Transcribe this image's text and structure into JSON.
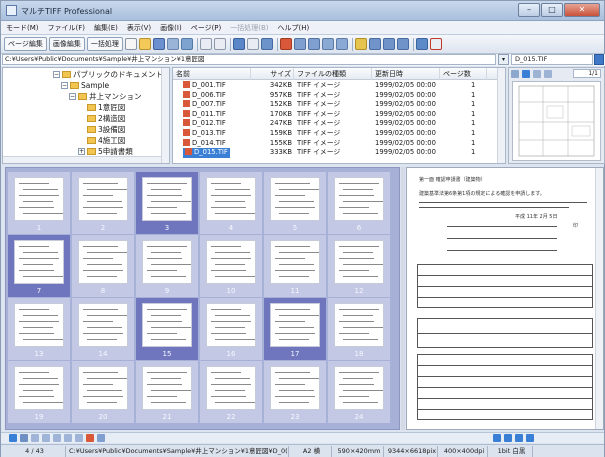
{
  "app": {
    "title": "マルチTIFF Professional"
  },
  "window_buttons": {
    "minimize": "–",
    "maximize": "□",
    "close": "✕"
  },
  "menu": [
    "モード(M)",
    "ファイル(F)",
    "編集(E)",
    "表示(V)",
    "画像(I)",
    "ページ(P)",
    "一括処理(B)",
    "ヘルプ(H)"
  ],
  "toolbar": {
    "page_edit": "ページ編集",
    "image_edit": "画像編集",
    "batch": "一括処理"
  },
  "path": {
    "value": "C:¥Users¥Public¥Documents¥Sample¥井上マンション¥1意匠図",
    "file": "D_015.TIF"
  },
  "tree": {
    "items": [
      {
        "label": "パブリックのドキュメント",
        "level": 1
      },
      {
        "label": "Sample",
        "level": 2
      },
      {
        "label": "井上マンション",
        "level": 3
      },
      {
        "label": "1意匠図",
        "level": 4
      },
      {
        "label": "2構造図",
        "level": 4
      },
      {
        "label": "3設備図",
        "level": 4
      },
      {
        "label": "4施工図",
        "level": 4
      },
      {
        "label": "5申請書類",
        "level": 4
      }
    ]
  },
  "filelist": {
    "columns": [
      "名前",
      "サイズ",
      "ファイルの種類",
      "更新日時",
      "ページ数"
    ],
    "rows": [
      {
        "name": "D_001.TIF",
        "size": "342KB",
        "type": "TIFF イメージ",
        "date": "1999/02/05 00:00",
        "pages": "1"
      },
      {
        "name": "D_006.TIF",
        "size": "957KB",
        "type": "TIFF イメージ",
        "date": "1999/02/05 00:00",
        "pages": "1"
      },
      {
        "name": "D_007.TIF",
        "size": "152KB",
        "type": "TIFF イメージ",
        "date": "1999/02/05 00:00",
        "pages": "1"
      },
      {
        "name": "D_011.TIF",
        "size": "170KB",
        "type": "TIFF イメージ",
        "date": "1999/02/05 00:00",
        "pages": "1"
      },
      {
        "name": "D_012.TIF",
        "size": "247KB",
        "type": "TIFF イメージ",
        "date": "1999/02/05 00:00",
        "pages": "1"
      },
      {
        "name": "D_013.TIF",
        "size": "159KB",
        "type": "TIFF イメージ",
        "date": "1999/02/05 00:00",
        "pages": "1"
      },
      {
        "name": "D_014.TIF",
        "size": "155KB",
        "type": "TIFF イメージ",
        "date": "1999/02/05 00:00",
        "pages": "1"
      },
      {
        "name": "D_015.TIF",
        "size": "333KB",
        "type": "TIFF イメージ",
        "date": "1999/02/05 00:00",
        "pages": "1",
        "selected": true
      }
    ]
  },
  "preview": {
    "page_counter": "1/1"
  },
  "thumbnails": {
    "pages": [
      {
        "num": "1"
      },
      {
        "num": "2"
      },
      {
        "num": "3",
        "selected": true
      },
      {
        "num": "4"
      },
      {
        "num": "5"
      },
      {
        "num": "6"
      },
      {
        "num": "7",
        "selected": true
      },
      {
        "num": "8"
      },
      {
        "num": "9"
      },
      {
        "num": "10"
      },
      {
        "num": "11"
      },
      {
        "num": "12"
      },
      {
        "num": "13"
      },
      {
        "num": "14"
      },
      {
        "num": "15",
        "selected": true
      },
      {
        "num": "16"
      },
      {
        "num": "17",
        "selected": true
      },
      {
        "num": "18"
      },
      {
        "num": "19"
      },
      {
        "num": "20"
      },
      {
        "num": "21"
      },
      {
        "num": "22"
      },
      {
        "num": "23"
      },
      {
        "num": "24"
      }
    ]
  },
  "document": {
    "line1": "第一面  確認申請書（建築物）",
    "line2": "建築基準法第6条第1項の規定による確認を申請します。",
    "date": "平成  11年  2月  5日",
    "sign": "印"
  },
  "status": {
    "page": "4 / 43",
    "path": "C:¥Users¥Public¥Documents¥Sample¥井上マンション¥1意匠図¥D_0(",
    "paper": "A2 横",
    "size": "590×420mm",
    "pixels": "9344×6618pix",
    "dpi": "400×400dpi",
    "color": "1bit 白黒"
  },
  "colors": {
    "thumb_bg": "#a7b0d6",
    "thumb_selected": "#6f76bd",
    "selection": "#3a7fd6"
  }
}
